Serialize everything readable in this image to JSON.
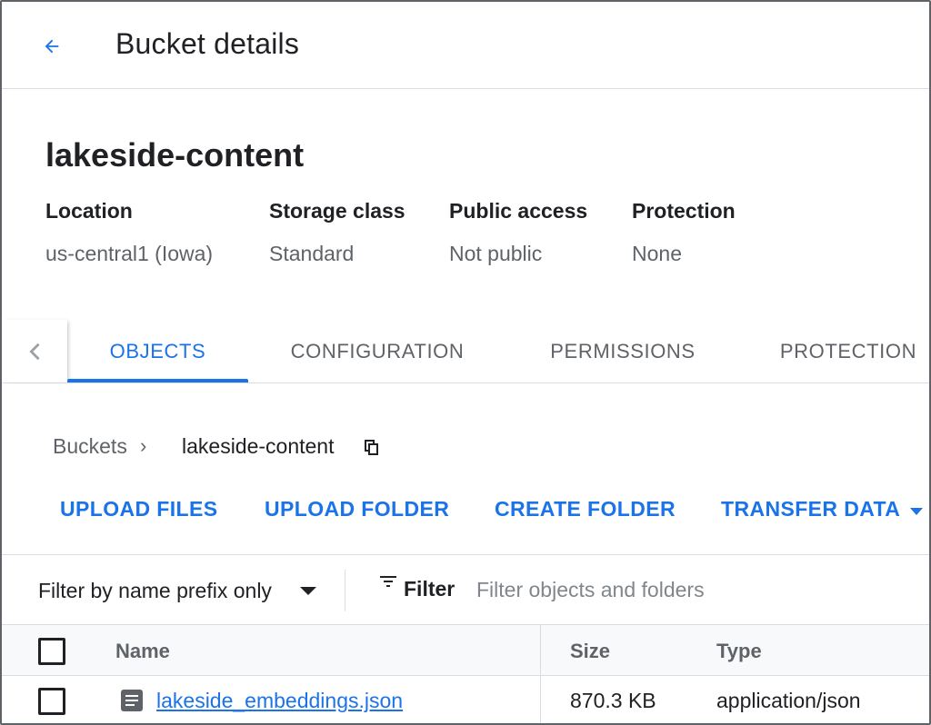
{
  "header": {
    "title": "Bucket details",
    "back_icon": "arrow-back-icon"
  },
  "bucket": {
    "name": "lakeside-content",
    "meta": [
      {
        "label": "Location",
        "value": "us-central1 (Iowa)"
      },
      {
        "label": "Storage class",
        "value": "Standard"
      },
      {
        "label": "Public access",
        "value": "Not public"
      },
      {
        "label": "Protection",
        "value": "None"
      }
    ]
  },
  "tabs": [
    {
      "label": "OBJECTS",
      "active": true
    },
    {
      "label": "CONFIGURATION",
      "active": false
    },
    {
      "label": "PERMISSIONS",
      "active": false
    },
    {
      "label": "PROTECTION",
      "active": false
    }
  ],
  "breadcrumb": {
    "root": "Buckets",
    "separator": "›",
    "current": "lakeside-content"
  },
  "actions": {
    "upload_files": "UPLOAD FILES",
    "upload_folder": "UPLOAD FOLDER",
    "create_folder": "CREATE FOLDER",
    "transfer_data": "TRANSFER DATA"
  },
  "filter": {
    "mode": "Filter by name prefix only",
    "label": "Filter",
    "placeholder": "Filter objects and folders"
  },
  "table": {
    "columns": {
      "name": "Name",
      "size": "Size",
      "type": "Type"
    },
    "rows": [
      {
        "name": "lakeside_embeddings.json",
        "size": "870.3 KB",
        "type": "application/json"
      }
    ]
  },
  "colors": {
    "accent": "#1a73e8",
    "text": "#202124",
    "muted": "#5f6368",
    "divider": "#dadce0"
  }
}
